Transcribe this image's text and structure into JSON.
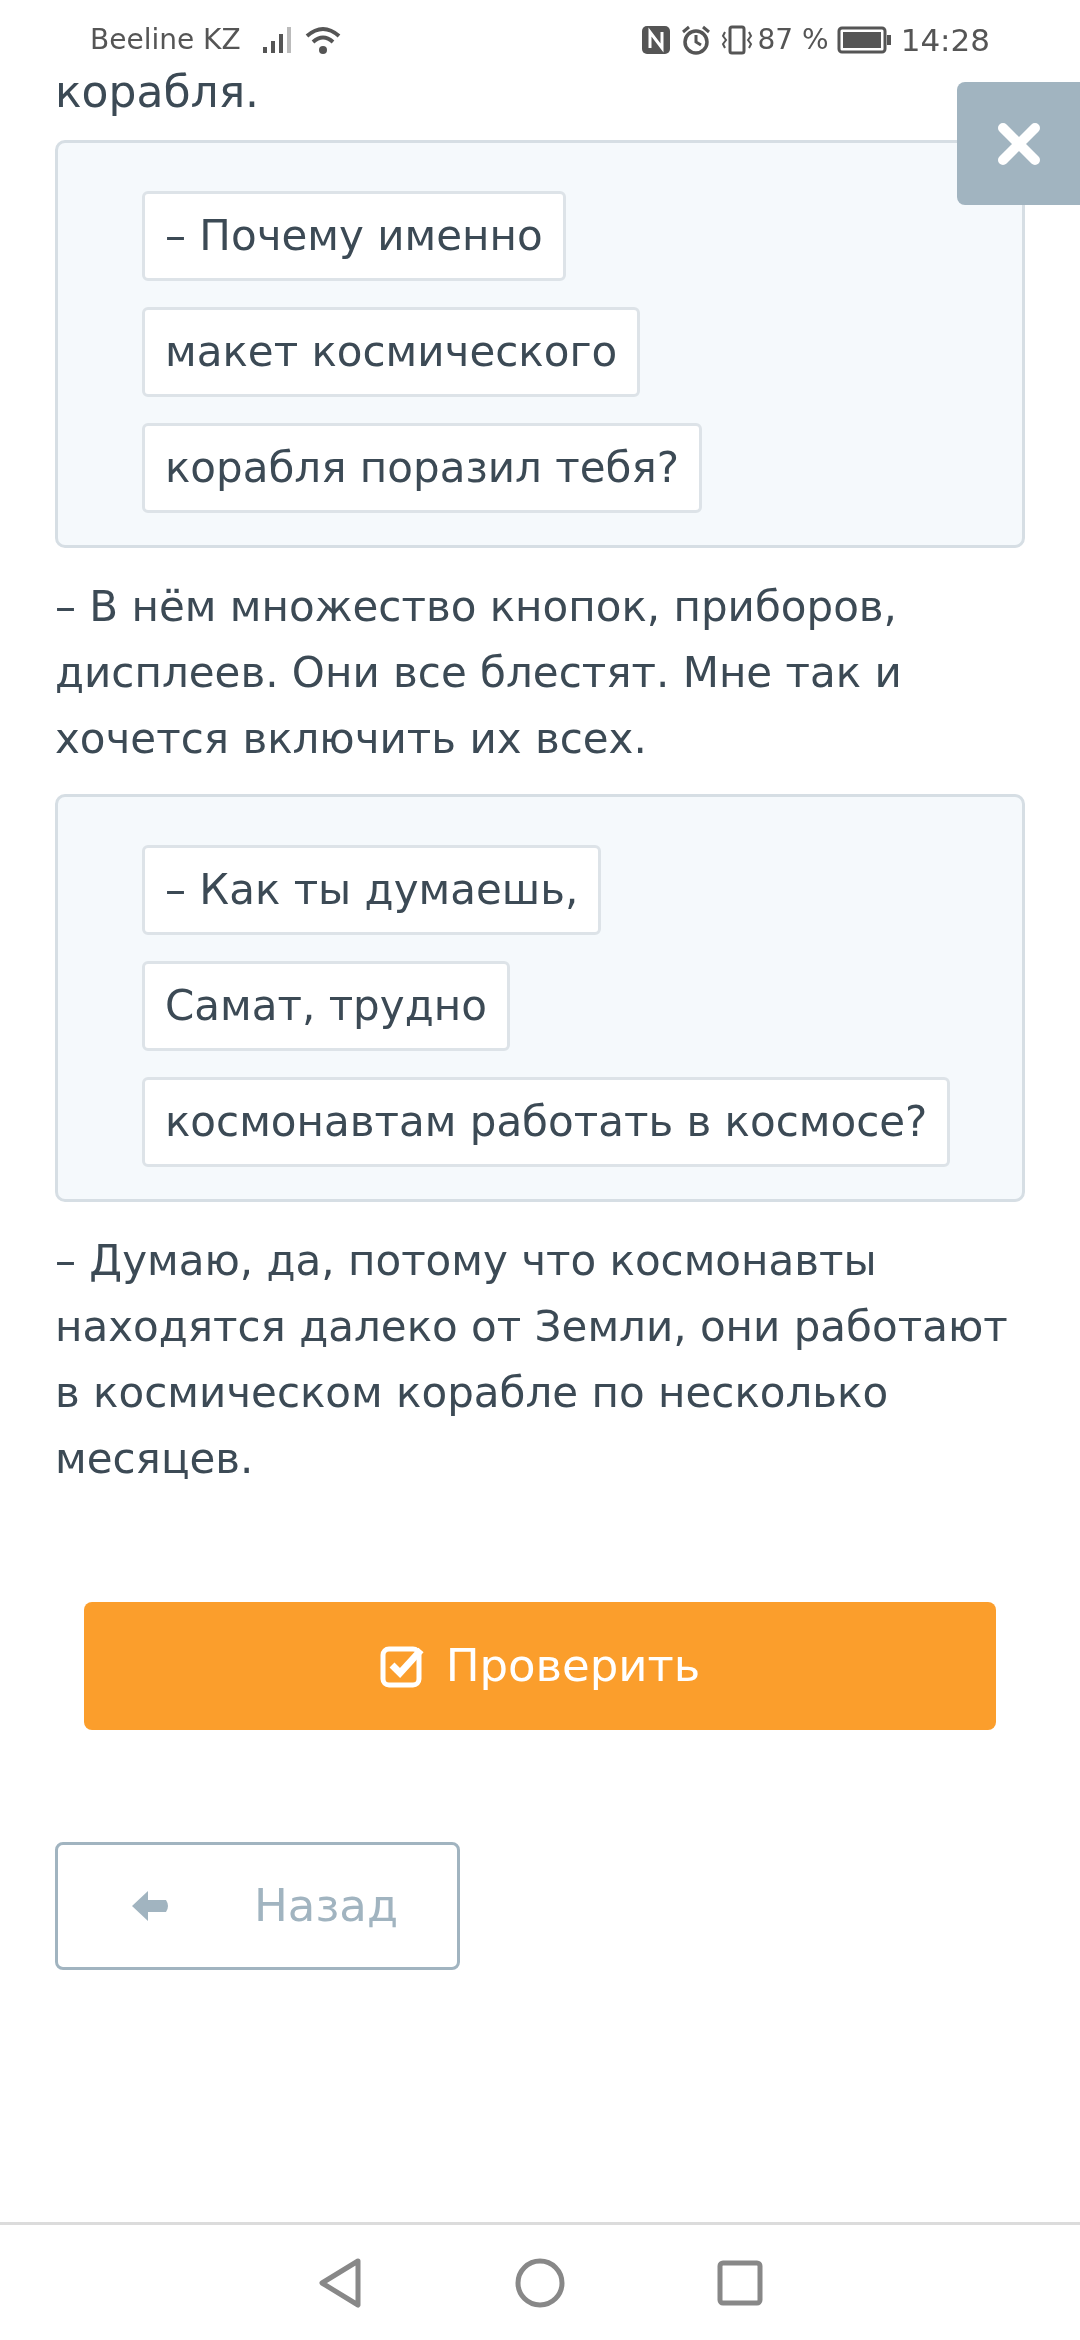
{
  "status_bar": {
    "carrier": "Beeline KZ",
    "battery": "87 %",
    "time": "14:28"
  },
  "top_text": "корабля.",
  "blocks": [
    {
      "kind": "chips",
      "items": [
        "– Почему именно",
        "макет космического",
        "корабля поразил тебя?"
      ]
    },
    {
      "kind": "text",
      "text": "– В нём множество кнопок, приборов, дисплеев. Они все блестят. Мне так и хочется включить их всех."
    },
    {
      "kind": "chips",
      "items": [
        "– Как ты думаешь,",
        "Самат, трудно",
        "космонавтам работать в космосе?"
      ]
    },
    {
      "kind": "text",
      "text": "– Думаю, да, потому что космонавты находятся далеко от Земли, они работают в космическом корабле по несколько месяцев."
    }
  ],
  "check_button": "Проверить",
  "back_button": "Назад"
}
